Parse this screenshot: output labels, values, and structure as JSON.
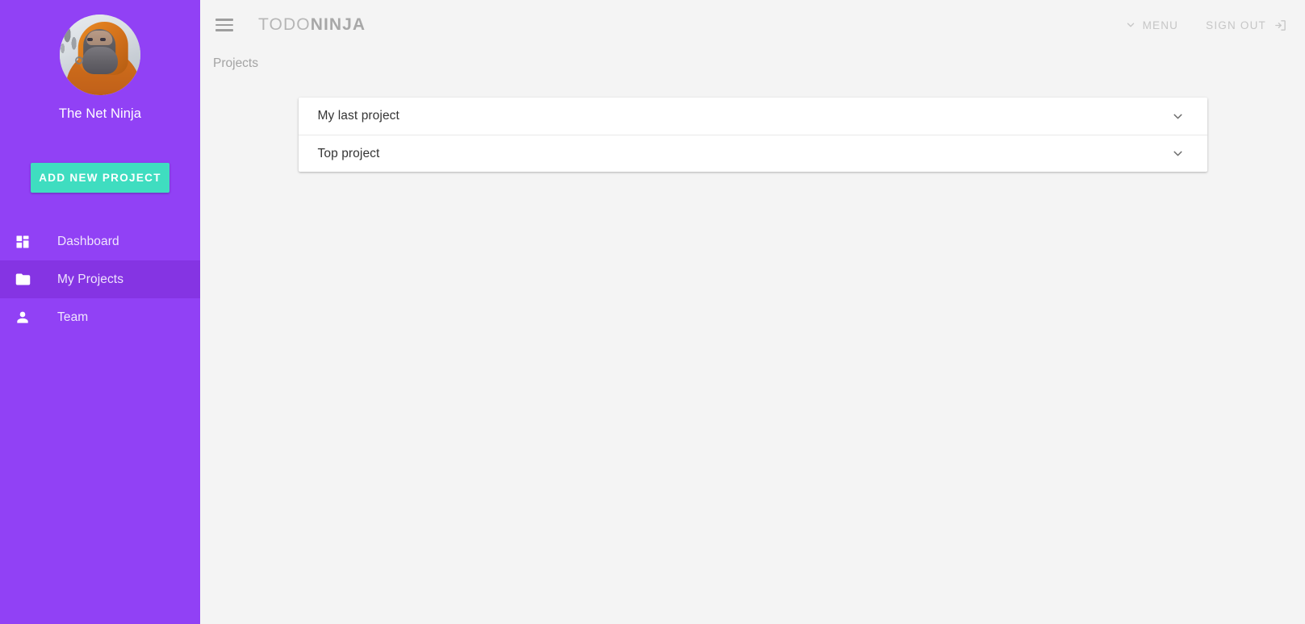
{
  "sidebar": {
    "avatar_alt": "user-avatar-photo",
    "user_name": "The Net Ninja",
    "add_project_label": "ADD NEW PROJECT",
    "accent_color": "#9141f5",
    "active_color": "#8534e3",
    "button_color": "#3fddc0",
    "items": [
      {
        "label": "Dashboard",
        "icon": "dashboard-icon",
        "active": false
      },
      {
        "label": "My Projects",
        "icon": "folder-icon",
        "active": true
      },
      {
        "label": "Team",
        "icon": "person-icon",
        "active": false
      }
    ]
  },
  "header": {
    "menu_toggle_icon": "hamburger-icon",
    "brand_prefix": "TODO",
    "brand_suffix": "NINJA",
    "menu_label": "MENU",
    "menu_icon": "chevron-down-icon",
    "sign_out_label": "SIGN OUT",
    "sign_out_icon": "exit-to-app-icon"
  },
  "breadcrumb": {
    "text": "Projects"
  },
  "projects": {
    "items": [
      {
        "title": "My last project",
        "expand_icon": "chevron-down-icon",
        "expanded": false
      },
      {
        "title": "Top project",
        "expand_icon": "chevron-down-icon",
        "expanded": false
      }
    ]
  }
}
